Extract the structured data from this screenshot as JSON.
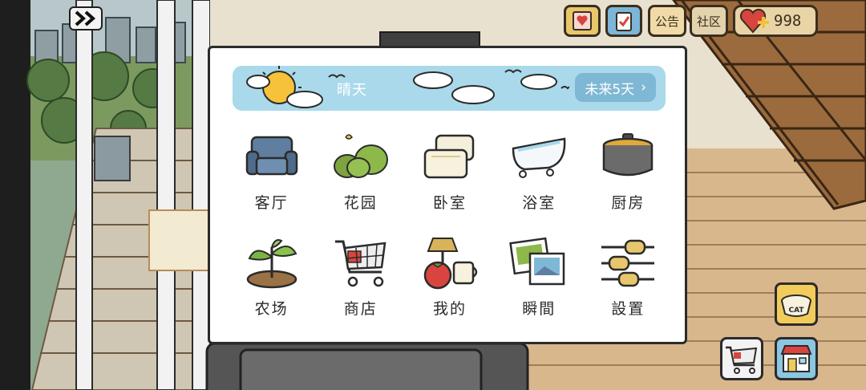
{
  "hud": {
    "notice_label": "公告",
    "community_label": "社区",
    "hearts": "998"
  },
  "weather": {
    "label": "晴天",
    "forecast_label": "未来5天"
  },
  "menu": {
    "items": [
      {
        "label": "客厅",
        "icon": "armchair-icon"
      },
      {
        "label": "花园",
        "icon": "bush-icon"
      },
      {
        "label": "卧室",
        "icon": "pillows-icon"
      },
      {
        "label": "浴室",
        "icon": "bathtub-icon"
      },
      {
        "label": "厨房",
        "icon": "cooking-pot-icon"
      },
      {
        "label": "农场",
        "icon": "sprout-icon"
      },
      {
        "label": "商店",
        "icon": "shopping-cart-icon"
      },
      {
        "label": "我的",
        "icon": "lamp-tomato-mug-icon"
      },
      {
        "label": "瞬間",
        "icon": "photos-icon"
      },
      {
        "label": "設置",
        "icon": "sliders-icon"
      }
    ]
  },
  "side": {
    "cat_food_label": "CAT"
  },
  "colors": {
    "panel_bg": "#ffffff",
    "weather_bar": "#a9d9eb",
    "forecast_btn": "#7fb8d4",
    "hud_gold": "#e8c66b",
    "floor_wood": "#d8b78d"
  }
}
